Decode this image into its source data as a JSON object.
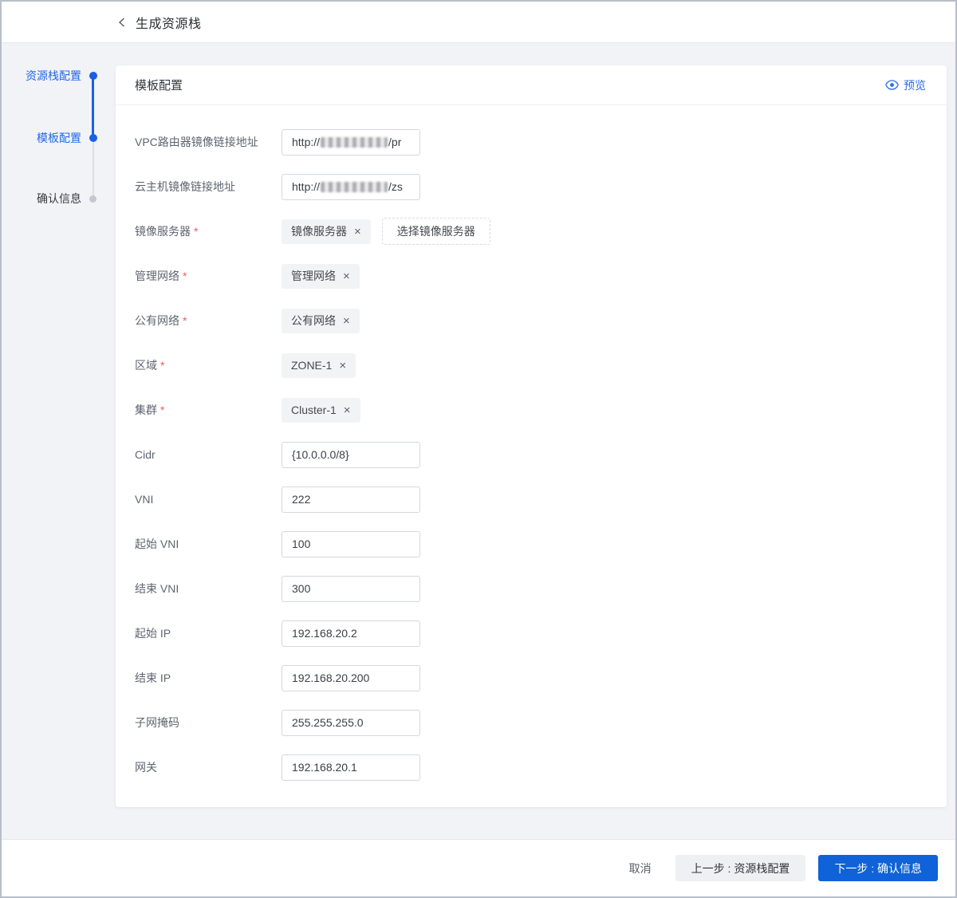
{
  "accent": {
    "primary_blue": "#0f62d7",
    "link_blue": "#2b6cea",
    "required_red": "#f25a5a"
  },
  "header": {
    "back_icon": "chevron-left-icon",
    "title": "生成资源栈"
  },
  "stepper": {
    "items": [
      {
        "label": "资源栈配置",
        "state": "done"
      },
      {
        "label": "模板配置",
        "state": "active"
      },
      {
        "label": "确认信息",
        "state": "pending"
      }
    ]
  },
  "panel": {
    "title": "模板配置",
    "preview": {
      "icon": "eye-icon",
      "label": "预览"
    }
  },
  "form": {
    "rows": [
      {
        "label": "VPC路由器镜像链接地址",
        "required": false,
        "type": "masked-input",
        "prefix": "http://",
        "masked": true,
        "suffix": "/pr"
      },
      {
        "label": "云主机镜像链接地址",
        "required": false,
        "type": "masked-input",
        "prefix": "http://",
        "masked": true,
        "suffix": "/zs"
      },
      {
        "label": "镜像服务器",
        "required": true,
        "type": "tag-button",
        "tag": "镜像服务器",
        "remove_icon": "×",
        "button": "选择镜像服务器"
      },
      {
        "label": "管理网络",
        "required": true,
        "type": "tag",
        "tag": "管理网络",
        "remove_icon": "×"
      },
      {
        "label": "公有网络",
        "required": true,
        "type": "tag",
        "tag": "公有网络",
        "remove_icon": "×"
      },
      {
        "label": "区域",
        "required": true,
        "type": "tag",
        "tag": "ZONE-1",
        "remove_icon": "×"
      },
      {
        "label": "集群",
        "required": true,
        "type": "tag",
        "tag": "Cluster-1",
        "remove_icon": "×"
      },
      {
        "label": "Cidr",
        "required": false,
        "type": "input",
        "value": "{10.0.0.0/8}"
      },
      {
        "label": "VNI",
        "required": false,
        "type": "input",
        "value": "222"
      },
      {
        "label": "起始 VNI",
        "required": false,
        "type": "input",
        "value": "100"
      },
      {
        "label": "结束 VNI",
        "required": false,
        "type": "input",
        "value": "300"
      },
      {
        "label": "起始 IP",
        "required": false,
        "type": "input",
        "value": "192.168.20.2"
      },
      {
        "label": "结束 IP",
        "required": false,
        "type": "input",
        "value": "192.168.20.200"
      },
      {
        "label": "子网掩码",
        "required": false,
        "type": "input",
        "value": "255.255.255.0"
      },
      {
        "label": "网关",
        "required": false,
        "type": "input",
        "value": "192.168.20.1"
      }
    ]
  },
  "footer": {
    "cancel_label": "取消",
    "prev_label": "上一步 : 资源栈配置",
    "next_label": "下一步 : 确认信息"
  }
}
